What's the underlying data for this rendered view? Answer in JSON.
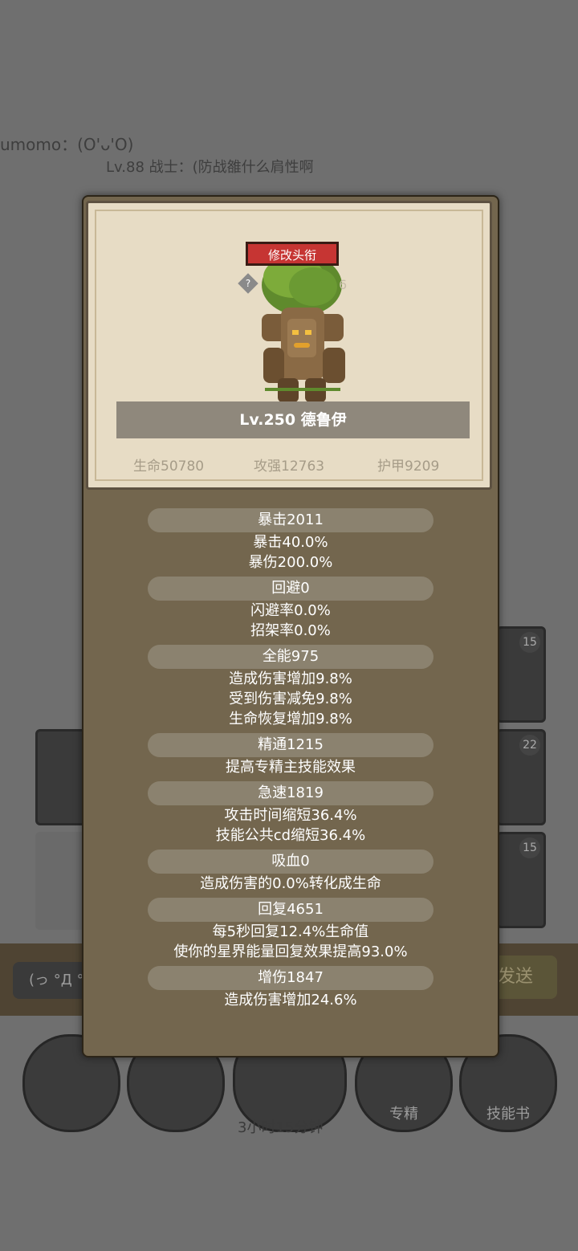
{
  "background": {
    "chat_line_1": "umomo：(O'ᴗ'O)",
    "chat_line_2": "Lv.88 战士：(防战雒什么肩性啊",
    "slot_counts": [
      "15",
      "22",
      "15"
    ],
    "chat_input": "(っ °Д °",
    "send_label": "发送",
    "buttons": [
      {
        "label": ""
      },
      {
        "label": ""
      },
      {
        "label": ""
      },
      {
        "label": "专精"
      },
      {
        "label": "技能书"
      }
    ],
    "timer": "3小时15分钟"
  },
  "card": {
    "edit_title_label": "修改头衔",
    "help_glyph": "?",
    "help_number": "6",
    "name": "Lv.250 德鲁伊",
    "stats": {
      "hp": "生命50780",
      "attack": "攻强12763",
      "armor": "护甲9209"
    }
  },
  "attributes": [
    {
      "header": "暴击2011",
      "lines": [
        "暴击40.0%",
        "暴伤200.0%"
      ]
    },
    {
      "header": "回避0",
      "lines": [
        "闪避率0.0%",
        "招架率0.0%"
      ]
    },
    {
      "header": "全能975",
      "lines": [
        "造成伤害增加9.8%",
        "受到伤害减免9.8%",
        "生命恢复增加9.8%"
      ]
    },
    {
      "header": "精通1215",
      "lines": [
        "提高专精主技能效果"
      ]
    },
    {
      "header": "急速1819",
      "lines": [
        "攻击时间缩短36.4%",
        "技能公共cd缩短36.4%"
      ]
    },
    {
      "header": "吸血0",
      "lines": [
        "造成伤害的0.0%转化成生命"
      ]
    },
    {
      "header": "回复4651",
      "lines": [
        "每5秒回复12.4%生命值",
        "使你的星界能量回复效果提高93.0%"
      ]
    },
    {
      "header": "增伤1847",
      "lines": [
        "造成伤害增加24.6%"
      ]
    }
  ]
}
